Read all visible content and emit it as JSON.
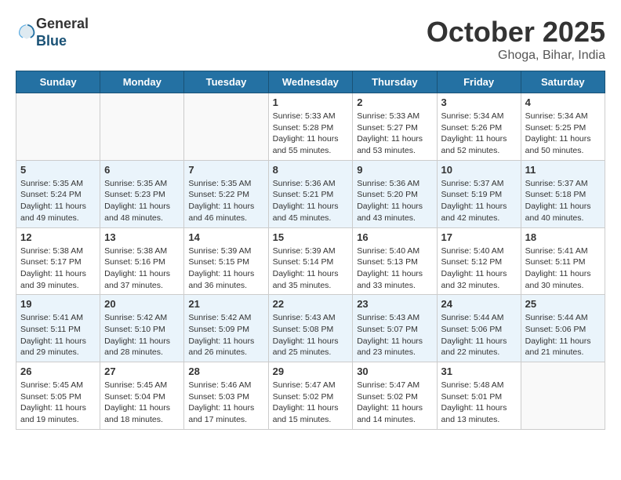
{
  "header": {
    "logo_line1": "General",
    "logo_line2": "Blue",
    "month": "October 2025",
    "location": "Ghoga, Bihar, India"
  },
  "days_of_week": [
    "Sunday",
    "Monday",
    "Tuesday",
    "Wednesday",
    "Thursday",
    "Friday",
    "Saturday"
  ],
  "weeks": [
    [
      {
        "day": "",
        "info": ""
      },
      {
        "day": "",
        "info": ""
      },
      {
        "day": "",
        "info": ""
      },
      {
        "day": "1",
        "info": "Sunrise: 5:33 AM\nSunset: 5:28 PM\nDaylight: 11 hours and 55 minutes."
      },
      {
        "day": "2",
        "info": "Sunrise: 5:33 AM\nSunset: 5:27 PM\nDaylight: 11 hours and 53 minutes."
      },
      {
        "day": "3",
        "info": "Sunrise: 5:34 AM\nSunset: 5:26 PM\nDaylight: 11 hours and 52 minutes."
      },
      {
        "day": "4",
        "info": "Sunrise: 5:34 AM\nSunset: 5:25 PM\nDaylight: 11 hours and 50 minutes."
      }
    ],
    [
      {
        "day": "5",
        "info": "Sunrise: 5:35 AM\nSunset: 5:24 PM\nDaylight: 11 hours and 49 minutes."
      },
      {
        "day": "6",
        "info": "Sunrise: 5:35 AM\nSunset: 5:23 PM\nDaylight: 11 hours and 48 minutes."
      },
      {
        "day": "7",
        "info": "Sunrise: 5:35 AM\nSunset: 5:22 PM\nDaylight: 11 hours and 46 minutes."
      },
      {
        "day": "8",
        "info": "Sunrise: 5:36 AM\nSunset: 5:21 PM\nDaylight: 11 hours and 45 minutes."
      },
      {
        "day": "9",
        "info": "Sunrise: 5:36 AM\nSunset: 5:20 PM\nDaylight: 11 hours and 43 minutes."
      },
      {
        "day": "10",
        "info": "Sunrise: 5:37 AM\nSunset: 5:19 PM\nDaylight: 11 hours and 42 minutes."
      },
      {
        "day": "11",
        "info": "Sunrise: 5:37 AM\nSunset: 5:18 PM\nDaylight: 11 hours and 40 minutes."
      }
    ],
    [
      {
        "day": "12",
        "info": "Sunrise: 5:38 AM\nSunset: 5:17 PM\nDaylight: 11 hours and 39 minutes."
      },
      {
        "day": "13",
        "info": "Sunrise: 5:38 AM\nSunset: 5:16 PM\nDaylight: 11 hours and 37 minutes."
      },
      {
        "day": "14",
        "info": "Sunrise: 5:39 AM\nSunset: 5:15 PM\nDaylight: 11 hours and 36 minutes."
      },
      {
        "day": "15",
        "info": "Sunrise: 5:39 AM\nSunset: 5:14 PM\nDaylight: 11 hours and 35 minutes."
      },
      {
        "day": "16",
        "info": "Sunrise: 5:40 AM\nSunset: 5:13 PM\nDaylight: 11 hours and 33 minutes."
      },
      {
        "day": "17",
        "info": "Sunrise: 5:40 AM\nSunset: 5:12 PM\nDaylight: 11 hours and 32 minutes."
      },
      {
        "day": "18",
        "info": "Sunrise: 5:41 AM\nSunset: 5:11 PM\nDaylight: 11 hours and 30 minutes."
      }
    ],
    [
      {
        "day": "19",
        "info": "Sunrise: 5:41 AM\nSunset: 5:11 PM\nDaylight: 11 hours and 29 minutes."
      },
      {
        "day": "20",
        "info": "Sunrise: 5:42 AM\nSunset: 5:10 PM\nDaylight: 11 hours and 28 minutes."
      },
      {
        "day": "21",
        "info": "Sunrise: 5:42 AM\nSunset: 5:09 PM\nDaylight: 11 hours and 26 minutes."
      },
      {
        "day": "22",
        "info": "Sunrise: 5:43 AM\nSunset: 5:08 PM\nDaylight: 11 hours and 25 minutes."
      },
      {
        "day": "23",
        "info": "Sunrise: 5:43 AM\nSunset: 5:07 PM\nDaylight: 11 hours and 23 minutes."
      },
      {
        "day": "24",
        "info": "Sunrise: 5:44 AM\nSunset: 5:06 PM\nDaylight: 11 hours and 22 minutes."
      },
      {
        "day": "25",
        "info": "Sunrise: 5:44 AM\nSunset: 5:06 PM\nDaylight: 11 hours and 21 minutes."
      }
    ],
    [
      {
        "day": "26",
        "info": "Sunrise: 5:45 AM\nSunset: 5:05 PM\nDaylight: 11 hours and 19 minutes."
      },
      {
        "day": "27",
        "info": "Sunrise: 5:45 AM\nSunset: 5:04 PM\nDaylight: 11 hours and 18 minutes."
      },
      {
        "day": "28",
        "info": "Sunrise: 5:46 AM\nSunset: 5:03 PM\nDaylight: 11 hours and 17 minutes."
      },
      {
        "day": "29",
        "info": "Sunrise: 5:47 AM\nSunset: 5:02 PM\nDaylight: 11 hours and 15 minutes."
      },
      {
        "day": "30",
        "info": "Sunrise: 5:47 AM\nSunset: 5:02 PM\nDaylight: 11 hours and 14 minutes."
      },
      {
        "day": "31",
        "info": "Sunrise: 5:48 AM\nSunset: 5:01 PM\nDaylight: 11 hours and 13 minutes."
      },
      {
        "day": "",
        "info": ""
      }
    ]
  ]
}
